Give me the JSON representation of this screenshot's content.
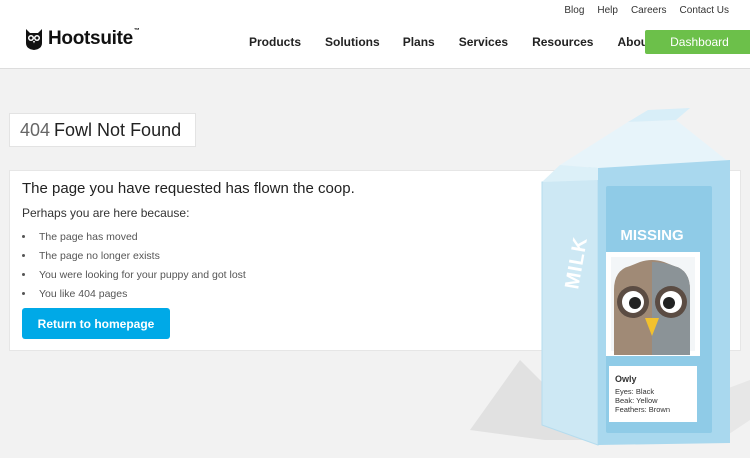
{
  "header": {
    "brand": "Hootsuite",
    "brand_tm": "™",
    "utility_nav": [
      "Blog",
      "Help",
      "Careers",
      "Contact Us"
    ],
    "main_nav": [
      "Products",
      "Solutions",
      "Plans",
      "Services",
      "Resources",
      "About Us"
    ],
    "dashboard_label": "Dashboard"
  },
  "error": {
    "code": "404",
    "title": "Fowl Not Found",
    "heading": "The page you have requested has flown the coop.",
    "subheading": "Perhaps you are here because:",
    "reasons": [
      "The page has moved",
      "The page no longer exists",
      "You were looking for your puppy and got lost",
      "You like 404 pages"
    ],
    "button_label": "Return to homepage"
  },
  "carton": {
    "side_label": "MILK",
    "missing_label": "MISSING",
    "name": "Owly",
    "details": [
      "Eyes: Black",
      "Beak: Yellow",
      "Feathers: Brown"
    ]
  },
  "colors": {
    "accent_green": "#6cc04a",
    "button_blue": "#00a9e7",
    "carton_blue": "#8ecbe6",
    "background": "#f2f2f2"
  }
}
